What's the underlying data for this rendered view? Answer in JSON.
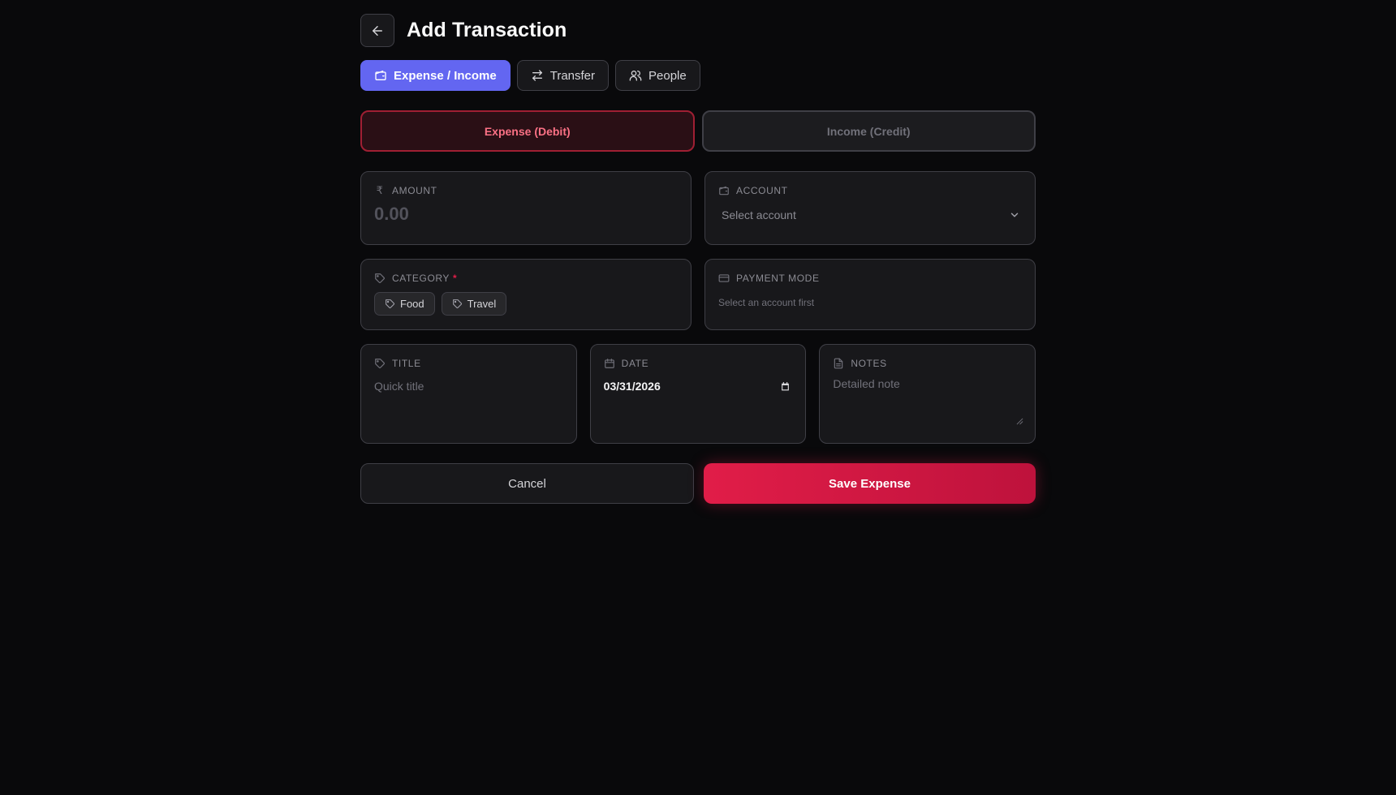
{
  "header": {
    "title": "Add Transaction",
    "back_icon": "arrow-left-icon"
  },
  "tabs": [
    {
      "label": "Expense / Income",
      "icon": "wallet-icon",
      "active": true
    },
    {
      "label": "Transfer",
      "icon": "arrows-transfer-icon",
      "active": false
    },
    {
      "label": "People",
      "icon": "users-icon",
      "active": false
    }
  ],
  "type_toggle": {
    "expense_label": "Expense (Debit)",
    "income_label": "Income (Credit)",
    "selected": "expense"
  },
  "amount": {
    "label": "AMOUNT",
    "currency_symbol": "₹",
    "placeholder": "0.00"
  },
  "account": {
    "label": "ACCOUNT",
    "placeholder": "Select account"
  },
  "category": {
    "label": "CATEGORY",
    "required_marker": "*",
    "chips": [
      "Food",
      "Travel"
    ]
  },
  "payment_mode": {
    "label": "PAYMENT MODE",
    "hint": "Select an account first"
  },
  "title_field": {
    "label": "TITLE",
    "placeholder": "Quick title"
  },
  "date_field": {
    "label": "DATE",
    "value": "03/31/2026"
  },
  "notes_field": {
    "label": "NOTES",
    "placeholder": "Detailed note"
  },
  "actions": {
    "cancel_label": "Cancel",
    "save_label": "Save Expense"
  },
  "colors": {
    "background": "#09090b",
    "accent": "#6366f1",
    "expense": "#e11d48",
    "card": "#18181b",
    "border": "#3f3f46"
  }
}
